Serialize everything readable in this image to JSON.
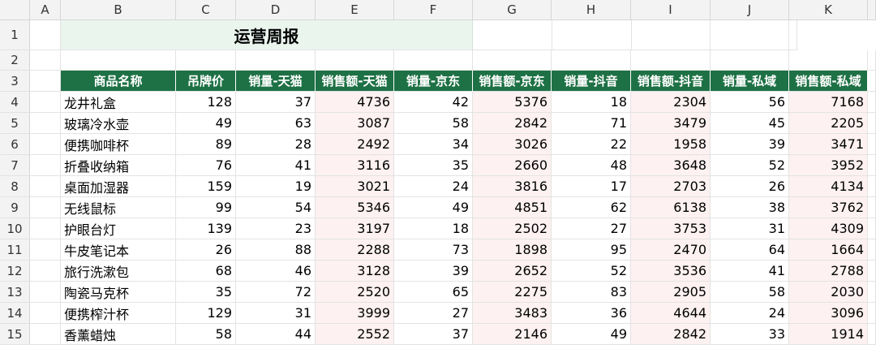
{
  "columns": [
    "A",
    "B",
    "C",
    "D",
    "E",
    "F",
    "G",
    "H",
    "I",
    "J",
    "K"
  ],
  "title": "运营周报",
  "headers": [
    "商品名称",
    "吊牌价",
    "销量-天猫",
    "销售额-天猫",
    "销量-京东",
    "销售额-京东",
    "销量-抖音",
    "销售额-抖音",
    "销量-私域",
    "销售额-私域"
  ],
  "rows": [
    {
      "n": "4",
      "cells": [
        "龙井礼盒",
        "128",
        "37",
        "4736",
        "42",
        "5376",
        "18",
        "2304",
        "56",
        "7168"
      ]
    },
    {
      "n": "5",
      "cells": [
        "玻璃冷水壶",
        "49",
        "63",
        "3087",
        "58",
        "2842",
        "71",
        "3479",
        "45",
        "2205"
      ]
    },
    {
      "n": "6",
      "cells": [
        "便携咖啡杯",
        "89",
        "28",
        "2492",
        "34",
        "3026",
        "22",
        "1958",
        "39",
        "3471"
      ]
    },
    {
      "n": "7",
      "cells": [
        "折叠收纳箱",
        "76",
        "41",
        "3116",
        "35",
        "2660",
        "48",
        "3648",
        "52",
        "3952"
      ]
    },
    {
      "n": "8",
      "cells": [
        "桌面加湿器",
        "159",
        "19",
        "3021",
        "24",
        "3816",
        "17",
        "2703",
        "26",
        "4134"
      ]
    },
    {
      "n": "9",
      "cells": [
        "无线鼠标",
        "99",
        "54",
        "5346",
        "49",
        "4851",
        "62",
        "6138",
        "38",
        "3762"
      ]
    },
    {
      "n": "10",
      "cells": [
        "护眼台灯",
        "139",
        "23",
        "3197",
        "18",
        "2502",
        "27",
        "3753",
        "31",
        "4309"
      ]
    },
    {
      "n": "11",
      "cells": [
        "牛皮笔记本",
        "26",
        "88",
        "2288",
        "73",
        "1898",
        "95",
        "2470",
        "64",
        "1664"
      ]
    },
    {
      "n": "12",
      "cells": [
        "旅行洗漱包",
        "68",
        "46",
        "3128",
        "39",
        "2652",
        "52",
        "3536",
        "41",
        "2788"
      ]
    },
    {
      "n": "13",
      "cells": [
        "陶瓷马克杯",
        "35",
        "72",
        "2520",
        "65",
        "2275",
        "83",
        "2905",
        "58",
        "2030"
      ]
    },
    {
      "n": "14",
      "cells": [
        "便携榨汁杯",
        "129",
        "31",
        "3999",
        "27",
        "3483",
        "36",
        "4644",
        "24",
        "3096"
      ]
    },
    {
      "n": "15",
      "cells": [
        "香薰蜡烛",
        "58",
        "44",
        "2552",
        "37",
        "2146",
        "49",
        "2842",
        "33",
        "1914"
      ]
    }
  ],
  "row_numbers": [
    "1",
    "2",
    "3"
  ]
}
